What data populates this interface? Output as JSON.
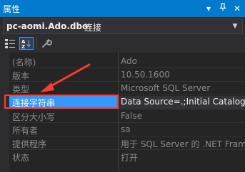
{
  "window": {
    "title": "属性"
  },
  "object_selector": {
    "name": "pc-aomi.Ado.dbo",
    "type": "连接"
  },
  "toolbar": {
    "categorized_icon": "categorized-icon",
    "alphabetical_icon": "sort-az-icon",
    "property_pages_icon": "wrench-icon"
  },
  "properties": [
    {
      "name": "(名称)",
      "value": "Ado"
    },
    {
      "name": "版本",
      "value": "10.50.1600"
    },
    {
      "name": "类型",
      "value": "Microsoft SQL Server"
    },
    {
      "name": "连接字符串",
      "value": "Data Source=.;Initial Catalog="
    },
    {
      "name": "区分大小写",
      "value": "False"
    },
    {
      "name": "所有者",
      "value": "sa"
    },
    {
      "name": "提供程序",
      "value": "用于 SQL Server 的 .NET Fram"
    },
    {
      "name": "状态",
      "value": "打开"
    }
  ],
  "colors": {
    "titlebar": "#007acc",
    "selection": "#3399ff",
    "annotation": "#ff3b30",
    "background": "#252526"
  }
}
